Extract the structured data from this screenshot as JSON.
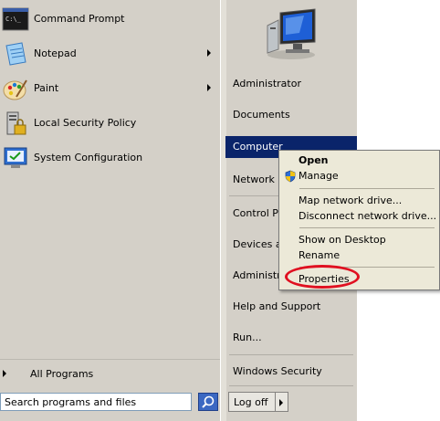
{
  "pinned_programs": [
    {
      "label": "Command Prompt",
      "icon": "command-prompt-icon",
      "has_submenu": false
    },
    {
      "label": "Notepad",
      "icon": "notepad-icon",
      "has_submenu": true
    },
    {
      "label": "Paint",
      "icon": "paint-icon",
      "has_submenu": true
    },
    {
      "label": "Local Security Policy",
      "icon": "local-security-policy-icon",
      "has_submenu": false
    },
    {
      "label": "System Configuration",
      "icon": "system-configuration-icon",
      "has_submenu": false
    }
  ],
  "all_programs_label": "All Programs",
  "search": {
    "placeholder": "Search programs and files",
    "value": "Search programs and files"
  },
  "right_pane": {
    "items": [
      {
        "label": "Administrator"
      },
      {
        "label": "Documents"
      },
      {
        "label": "Computer",
        "selected": true
      },
      {
        "label": "Network"
      },
      {
        "label": "Control Pa"
      },
      {
        "label": "Devices ar"
      },
      {
        "label": "Administra"
      },
      {
        "label": "Help and Support"
      },
      {
        "label": "Run..."
      },
      {
        "label": "Windows Security"
      }
    ]
  },
  "logoff_label": "Log off",
  "context_menu": {
    "items": [
      {
        "label": "Open",
        "bold": true
      },
      {
        "label": "Manage",
        "icon": "shield-icon"
      },
      {
        "label": "Map network drive..."
      },
      {
        "label": "Disconnect network drive..."
      },
      {
        "label": "Show on Desktop"
      },
      {
        "label": "Rename"
      },
      {
        "label": "Properties",
        "highlighted": true
      }
    ]
  },
  "colors": {
    "menu_bg": "#d4d0c8",
    "selection": "#0a246a",
    "context_bg": "#ece9d8",
    "annotation": "#e01020"
  }
}
